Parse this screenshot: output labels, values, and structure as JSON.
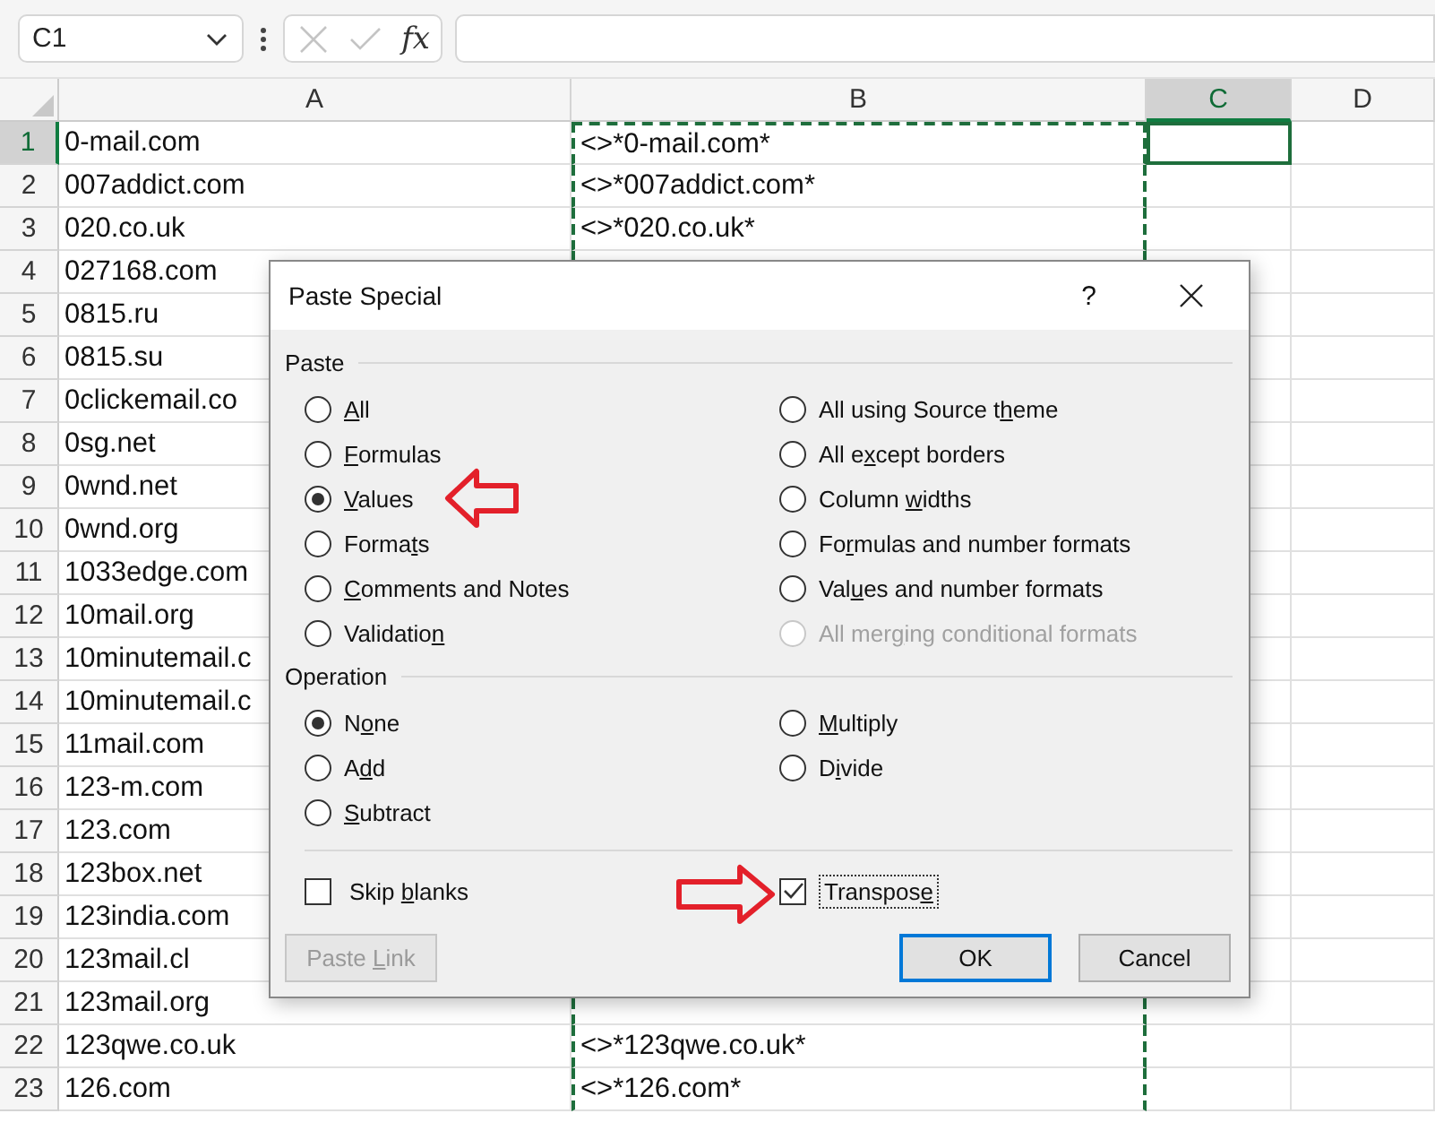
{
  "formula_bar": {
    "name_box": "C1",
    "function_label": "fx"
  },
  "sheet": {
    "columns": [
      {
        "label": "A",
        "selected": false,
        "marquee": false
      },
      {
        "label": "B",
        "selected": false,
        "marquee": true
      },
      {
        "label": "C",
        "selected": true,
        "marquee": false
      },
      {
        "label": "D",
        "selected": false,
        "marquee": false
      }
    ],
    "rows": [
      {
        "number": "1",
        "selected": true,
        "a": "0-mail.com",
        "b": "<>*0-mail.com*"
      },
      {
        "number": "2",
        "selected": false,
        "a": "007addict.com",
        "b": "<>*007addict.com*"
      },
      {
        "number": "3",
        "selected": false,
        "a": "020.co.uk",
        "b": "<>*020.co.uk*"
      },
      {
        "number": "4",
        "selected": false,
        "a": "027168.com"
      },
      {
        "number": "5",
        "selected": false,
        "a": "0815.ru"
      },
      {
        "number": "6",
        "selected": false,
        "a": "0815.su"
      },
      {
        "number": "7",
        "selected": false,
        "a": "0clickemail.co"
      },
      {
        "number": "8",
        "selected": false,
        "a": "0sg.net"
      },
      {
        "number": "9",
        "selected": false,
        "a": "0wnd.net"
      },
      {
        "number": "10",
        "selected": false,
        "a": "0wnd.org"
      },
      {
        "number": "11",
        "selected": false,
        "a": "1033edge.com"
      },
      {
        "number": "12",
        "selected": false,
        "a": "10mail.org"
      },
      {
        "number": "13",
        "selected": false,
        "a": "10minutemail.c"
      },
      {
        "number": "14",
        "selected": false,
        "a": "10minutemail.c"
      },
      {
        "number": "15",
        "selected": false,
        "a": "11mail.com"
      },
      {
        "number": "16",
        "selected": false,
        "a": "123-m.com"
      },
      {
        "number": "17",
        "selected": false,
        "a": "123.com"
      },
      {
        "number": "18",
        "selected": false,
        "a": "123box.net"
      },
      {
        "number": "19",
        "selected": false,
        "a": "123india.com"
      },
      {
        "number": "20",
        "selected": false,
        "a": "123mail.cl"
      },
      {
        "number": "21",
        "selected": false,
        "a": "123mail.org"
      },
      {
        "number": "22",
        "selected": false,
        "a": "123qwe.co.uk",
        "b": "<>*123qwe.co.uk*"
      },
      {
        "number": "23",
        "selected": false,
        "a": "126.com",
        "b": "<>*126.com*"
      }
    ]
  },
  "dialog": {
    "title": "Paste Special",
    "help": "?",
    "paste": {
      "label": "Paste",
      "columns": [
        [
          {
            "key": "A",
            "post": "ll",
            "selected": false,
            "disabled": false
          },
          {
            "key": "F",
            "post": "ormulas",
            "selected": false,
            "disabled": false
          },
          {
            "key": "V",
            "post": "alues",
            "selected": true,
            "disabled": false
          },
          {
            "pre": "Forma",
            "key": "t",
            "post": "s",
            "selected": false,
            "disabled": false
          },
          {
            "key": "C",
            "post": "omments and Notes",
            "selected": false,
            "disabled": false
          },
          {
            "pre": "Validatio",
            "key": "n",
            "selected": false,
            "disabled": false
          }
        ],
        [
          {
            "pre": "All using Source t",
            "key": "h",
            "post": "eme",
            "selected": false,
            "disabled": false
          },
          {
            "pre": "All e",
            "key": "x",
            "post": "cept borders",
            "selected": false,
            "disabled": false
          },
          {
            "pre": "Column ",
            "key": "w",
            "post": "idths",
            "selected": false,
            "disabled": false
          },
          {
            "pre": "Fo",
            "key": "r",
            "post": "mulas and number formats",
            "selected": false,
            "disabled": false
          },
          {
            "pre": "Val",
            "key": "u",
            "post": "es and number formats",
            "selected": false,
            "disabled": false
          },
          {
            "pre": "All mer",
            "key": "g",
            "post": "ing conditional formats",
            "selected": false,
            "disabled": true
          }
        ]
      ]
    },
    "operation": {
      "label": "Operation",
      "columns": [
        [
          {
            "pre": "N",
            "key": "o",
            "post": "ne",
            "selected": true,
            "disabled": false
          },
          {
            "pre": "A",
            "key": "d",
            "post": "d",
            "selected": false,
            "disabled": false
          },
          {
            "key": "S",
            "post": "ubtract",
            "selected": false,
            "disabled": false
          }
        ],
        [
          {
            "key": "M",
            "post": "ultiply",
            "selected": false,
            "disabled": false
          },
          {
            "pre": "D",
            "key": "i",
            "post": "vide",
            "selected": false,
            "disabled": false
          }
        ]
      ]
    },
    "checkboxes": [
      {
        "pre": "Skip ",
        "key": "b",
        "post": "lanks",
        "checked": false,
        "focused": false
      },
      {
        "pre": "Transpos",
        "key": "e",
        "checked": true,
        "focused": true
      }
    ],
    "link_button": {
      "pre": "Paste ",
      "key": "L",
      "post": "ink",
      "disabled": true
    },
    "buttons": [
      {
        "pre": "OK",
        "default": true
      },
      {
        "pre": "Cancel",
        "default": false
      }
    ]
  }
}
